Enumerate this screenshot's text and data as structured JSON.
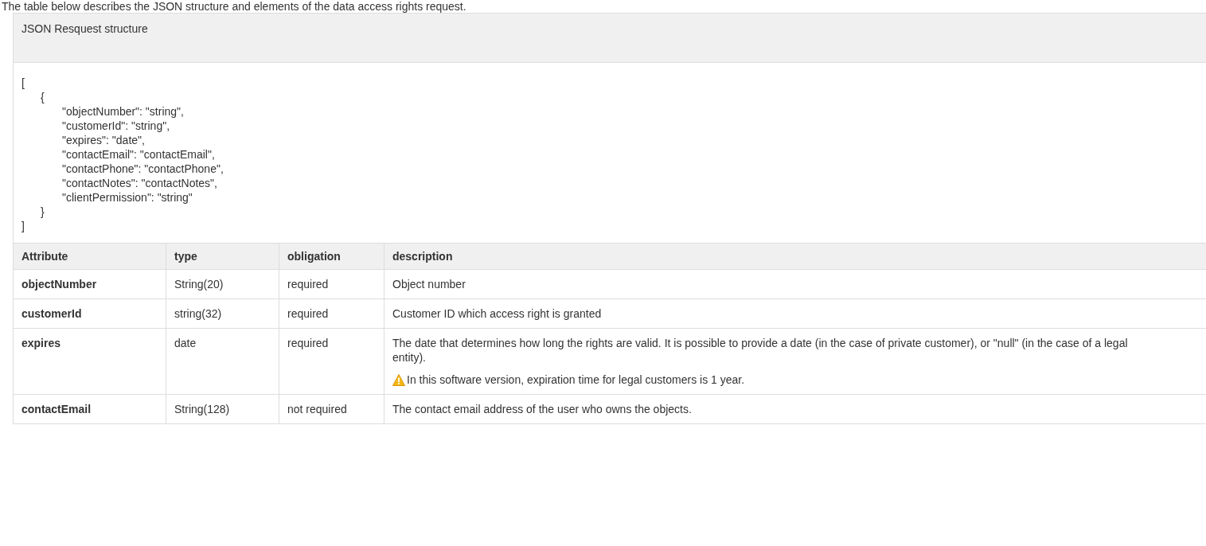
{
  "intro": "The table below describes the JSON structure and elements of the data access rights request.",
  "code_panel": {
    "title": "JSON Resquest structure",
    "code": {
      "open": "[",
      "close": "]",
      "children": [
        {
          "open": "{",
          "close": "}",
          "children": [
            "\"objectNumber\": \"string\",",
            "\"customerId\": \"string\",",
            "\"expires\": \"date\",",
            "\"contactEmail\": \"contactEmail\",",
            "\"contactPhone\": \"contactPhone\",",
            "\"contactNotes\": \"contactNotes\",",
            "\"clientPermission\": \"string\""
          ]
        }
      ]
    }
  },
  "table": {
    "columns": [
      "Attribute",
      "type",
      "obligation",
      "description"
    ],
    "rows": [
      {
        "attribute": "objectNumber",
        "type": "String(20)",
        "obligation": "required",
        "description": "Object number"
      },
      {
        "attribute": "customerId",
        "type": "string(32)",
        "obligation": "required",
        "description": "Customer ID which access right is granted"
      },
      {
        "attribute": "expires",
        "type": "date",
        "obligation": "required",
        "description": "The date that determines how long the rights are valid. It is possible to provide a date (in the case of private customer), or \"null\" (in the case of a legal entity).",
        "note": {
          "kind": "warning",
          "text": "In this software version, expiration time for legal customers is 1 year."
        }
      },
      {
        "attribute": "contactEmail",
        "type": "String(128)",
        "obligation": "not required",
        "description": "The contact email address of the user who owns the objects."
      }
    ]
  }
}
